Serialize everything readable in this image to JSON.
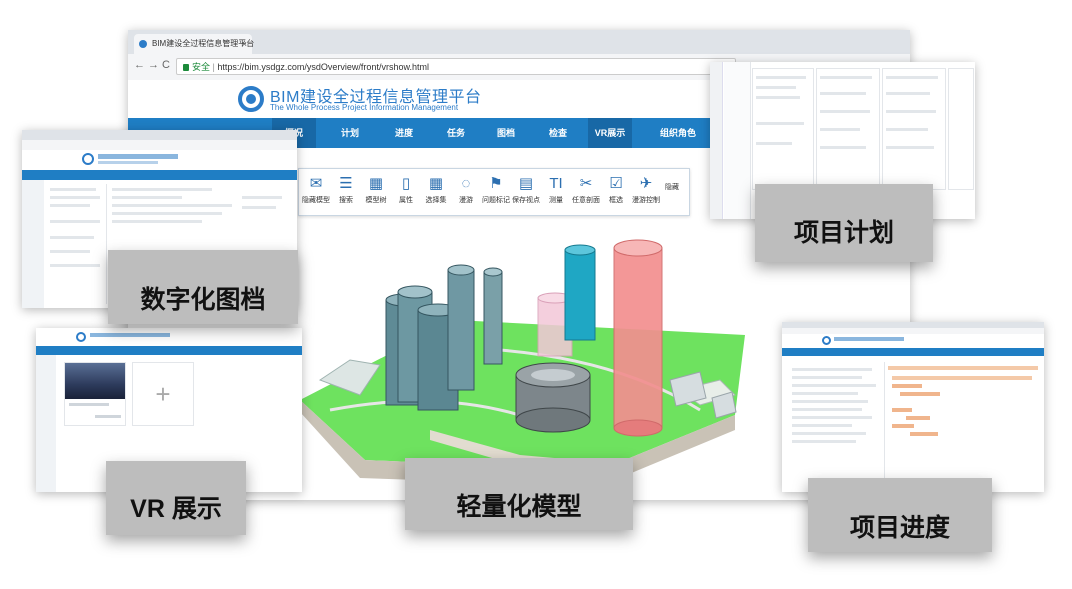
{
  "browser": {
    "tab_title": "BIM建设全过程信息管理平台",
    "tab_close": "×",
    "url_secure": "安全",
    "url_separator": "|",
    "url": "https://bim.ysdgz.com/ysdOverview/front/vrshow.html"
  },
  "site": {
    "brand_title": "BIM建设全过程信息管理平台",
    "brand_subtitle": "The Whole Process Project Information Management"
  },
  "nav": {
    "items": [
      {
        "label": "概况"
      },
      {
        "label": "计划"
      },
      {
        "label": "进度"
      },
      {
        "label": "任务"
      },
      {
        "label": "图档"
      },
      {
        "label": "检查"
      },
      {
        "label": "VR展示"
      },
      {
        "label": "组织角色"
      }
    ],
    "active_index": 0
  },
  "toolbar": {
    "tools": [
      {
        "label": "隐藏模型",
        "icon": "envelope-icon"
      },
      {
        "label": "搜索",
        "icon": "list-icon"
      },
      {
        "label": "模型树",
        "icon": "grid-icon"
      },
      {
        "label": "属性",
        "icon": "phone-icon"
      },
      {
        "label": "选择集",
        "icon": "grid-icon"
      },
      {
        "label": "漫游",
        "icon": "dotted-circle-icon"
      },
      {
        "label": "问题标记",
        "icon": "flag-icon"
      },
      {
        "label": "保存视点",
        "icon": "film-icon"
      },
      {
        "label": "测量",
        "icon": "text-icon"
      },
      {
        "label": "任意剖面",
        "icon": "scissors-icon"
      },
      {
        "label": "框选",
        "icon": "checkbox-icon"
      },
      {
        "label": "漫游控制",
        "icon": "plane-icon"
      },
      {
        "label": "隐藏",
        "icon": "none"
      }
    ]
  },
  "captions": {
    "plan": "项目计划",
    "docs": "数字化图档",
    "vr": "VR 展示",
    "model": "轻量化模型",
    "progress": "项目进度"
  },
  "vr_panel": {
    "add_symbol": "+"
  },
  "colors": {
    "nav_blue": "#1f7ec4",
    "caption_gray": "#bdbdbd",
    "ground_green": "#69e25c",
    "tower_pink": "#f28f8f",
    "tower_cyan": "#1fa7c4"
  }
}
